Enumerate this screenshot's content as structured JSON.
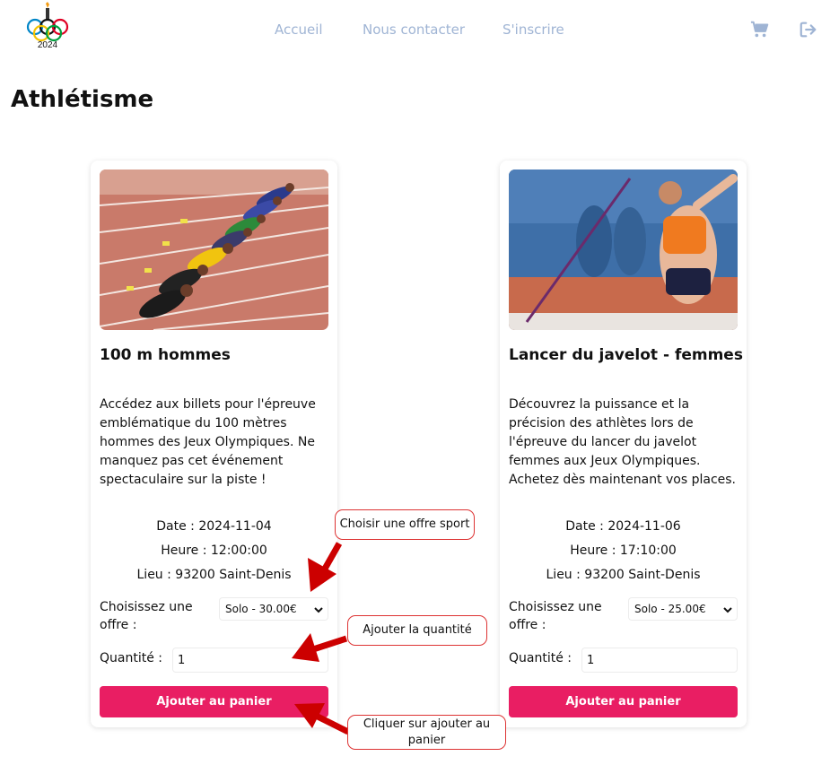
{
  "logo": {
    "year": "2024"
  },
  "nav": {
    "home": "Accueil",
    "contact": "Nous contacter",
    "signup": "S'inscrire"
  },
  "icons": {
    "cart": "cart-icon",
    "logout": "logout-icon"
  },
  "page_title": "Athlétisme",
  "colors": {
    "accent": "#e91e63",
    "nav": "#9fb4d4",
    "annotation": "#cc0000"
  },
  "cards": [
    {
      "title": "100 m hommes",
      "description": "Accédez aux billets pour l'épreuve emblématique du 100 mètres hommes des Jeux Olympiques. Ne manquez pas cet événement spectaculaire sur la piste !",
      "date": "Date : 2024-11-04",
      "time": "Heure : 12:00:00",
      "place": "Lieu : 93200 Saint-Denis",
      "offer_label": "Choisissez une offre :",
      "offer_selected": "Solo - 30.00€",
      "quantity_label": "Quantité :",
      "quantity_value": "1",
      "button": "Ajouter au panier"
    },
    {
      "title": "Lancer du javelot - femmes",
      "description": "Découvrez la puissance et la précision des athlètes lors de l'épreuve du lancer du javelot femmes aux Jeux Olympiques. Achetez dès maintenant vos places.",
      "date": "Date : 2024-11-06",
      "time": "Heure : 17:10:00",
      "place": "Lieu : 93200 Saint-Denis",
      "offer_label": "Choisissez une offre :",
      "offer_selected": "Solo - 25.00€",
      "quantity_label": "Quantité :",
      "quantity_value": "1",
      "button": "Ajouter au panier"
    }
  ],
  "annotations": {
    "choose_offer": "Choisir une offre sport",
    "add_quantity": "Ajouter la quantité",
    "add_to_cart": "Cliquer sur ajouter au panier"
  }
}
